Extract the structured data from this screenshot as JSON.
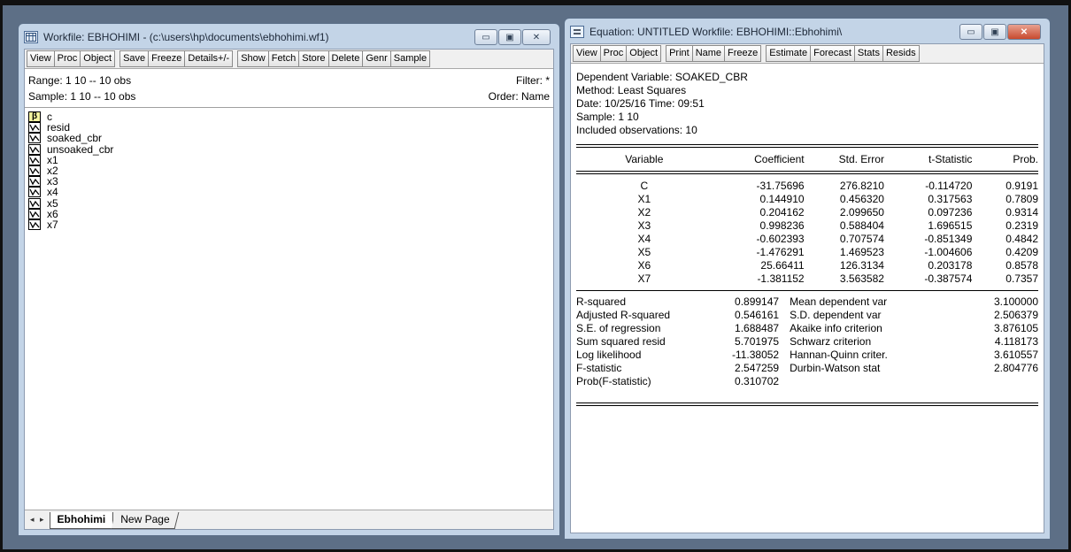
{
  "workfile_window": {
    "title": "Workfile: EBHOHIMI - (c:\\users\\hp\\documents\\ebhohimi.wf1)",
    "toolbar": [
      "View",
      "Proc",
      "Object",
      "Save",
      "Freeze",
      "Details+/-",
      "Show",
      "Fetch",
      "Store",
      "Delete",
      "Genr",
      "Sample"
    ],
    "range": "Range:  1 10  --  10 obs",
    "filter": "Filter: *",
    "sample": "Sample: 1 10  --  10 obs",
    "order": "Order: Name",
    "objects": [
      {
        "name": "c",
        "type": "coef"
      },
      {
        "name": "resid",
        "type": "series"
      },
      {
        "name": "soaked_cbr",
        "type": "series"
      },
      {
        "name": "unsoaked_cbr",
        "type": "series"
      },
      {
        "name": "x1",
        "type": "series"
      },
      {
        "name": "x2",
        "type": "series"
      },
      {
        "name": "x3",
        "type": "series"
      },
      {
        "name": "x4",
        "type": "series"
      },
      {
        "name": "x5",
        "type": "series"
      },
      {
        "name": "x6",
        "type": "series"
      },
      {
        "name": "x7",
        "type": "series"
      }
    ],
    "coef_icon_glyph": "β",
    "tab_arrows": "◂ ▸",
    "tabs": [
      "Ebhohimi",
      "New Page"
    ]
  },
  "equation_window": {
    "title": "Equation: UNTITLED   Workfile: EBHOHIMI::Ebhohimi\\",
    "toolbar": [
      "View",
      "Proc",
      "Object",
      "Print",
      "Name",
      "Freeze",
      "Estimate",
      "Forecast",
      "Stats",
      "Resids"
    ],
    "header": [
      "Dependent Variable: SOAKED_CBR",
      "Method: Least Squares",
      "Date: 10/25/16   Time: 09:51",
      "Sample: 1 10",
      "Included observations: 10"
    ],
    "columns": [
      "Variable",
      "Coefficient",
      "Std. Error",
      "t-Statistic",
      "Prob."
    ],
    "rows": [
      [
        "C",
        "-31.75696",
        "276.8210",
        "-0.114720",
        "0.9191"
      ],
      [
        "X1",
        "0.144910",
        "0.456320",
        "0.317563",
        "0.7809"
      ],
      [
        "X2",
        "0.204162",
        "2.099650",
        "0.097236",
        "0.9314"
      ],
      [
        "X3",
        "0.998236",
        "0.588404",
        "1.696515",
        "0.2319"
      ],
      [
        "X4",
        "-0.602393",
        "0.707574",
        "-0.851349",
        "0.4842"
      ],
      [
        "X5",
        "-1.476291",
        "1.469523",
        "-1.004606",
        "0.4209"
      ],
      [
        "X6",
        "25.66411",
        "126.3134",
        "0.203178",
        "0.8578"
      ],
      [
        "X7",
        "-1.381152",
        "3.563582",
        "-0.387574",
        "0.7357"
      ]
    ],
    "stats": [
      [
        "R-squared",
        "0.899147",
        "Mean dependent var",
        "3.100000"
      ],
      [
        "Adjusted R-squared",
        "0.546161",
        "S.D. dependent var",
        "2.506379"
      ],
      [
        "S.E. of regression",
        "1.688487",
        "Akaike info criterion",
        "3.876105"
      ],
      [
        "Sum squared resid",
        "5.701975",
        "Schwarz criterion",
        "4.118173"
      ],
      [
        "Log likelihood",
        "-11.38052",
        "Hannan-Quinn criter.",
        "3.610557"
      ],
      [
        "F-statistic",
        "2.547259",
        "Durbin-Watson stat",
        "2.804776"
      ],
      [
        "Prob(F-statistic)",
        "0.310702",
        "",
        ""
      ]
    ]
  }
}
